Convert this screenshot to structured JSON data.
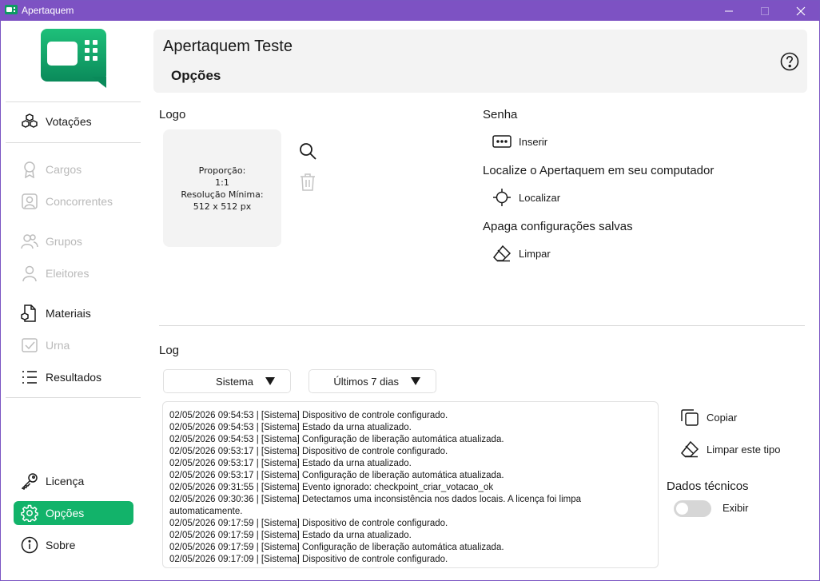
{
  "window": {
    "title": "Apertaquem"
  },
  "colors": {
    "titlebar": "#7d52c3",
    "accent": "#12b36a",
    "brand": "#0c9a63"
  },
  "sidebar": {
    "items": [
      {
        "label": "Votações",
        "icon": "cubes-icon",
        "state": "normal"
      },
      {
        "label": "Cargos",
        "icon": "ribbon-icon",
        "state": "disabled"
      },
      {
        "label": "Concorrentes",
        "icon": "person-card-icon",
        "state": "disabled"
      },
      {
        "label": "Grupos",
        "icon": "people-icon",
        "state": "disabled"
      },
      {
        "label": "Eleitores",
        "icon": "person-icon",
        "state": "disabled"
      },
      {
        "label": "Materiais",
        "icon": "document-cube-icon",
        "state": "normal"
      },
      {
        "label": "Urna",
        "icon": "ballot-box-icon",
        "state": "disabled"
      },
      {
        "label": "Resultados",
        "icon": "list-icon",
        "state": "normal"
      },
      {
        "label": "Licença",
        "icon": "key-icon",
        "state": "normal"
      },
      {
        "label": "Opções",
        "icon": "gear-icon",
        "state": "active"
      },
      {
        "label": "Sobre",
        "icon": "info-icon",
        "state": "normal"
      }
    ]
  },
  "header": {
    "app_name": "Apertaquem Teste",
    "page_title": "Opções"
  },
  "logo": {
    "label": "Logo",
    "drop_lines": [
      "Proporção:",
      "1:1",
      "Resolução Mínima:",
      "512 x 512 px"
    ]
  },
  "password": {
    "label": "Senha",
    "action": "Inserir"
  },
  "locate": {
    "label": "Localize o Apertaquem em seu computador",
    "action": "Localizar"
  },
  "clear_settings": {
    "label": "Apaga configurações salvas",
    "action": "Limpar"
  },
  "log": {
    "label": "Log",
    "type_filter": "Sistema",
    "period_filter": "Últimos 7 dias",
    "lines": [
      "02/05/2026 09:54:53 | [Sistema] Dispositivo de controle configurado.",
      "02/05/2026 09:54:53 | [Sistema] Estado da urna atualizado.",
      "02/05/2026 09:54:53 | [Sistema] Configuração de liberação automática atualizada.",
      "02/05/2026 09:53:17 | [Sistema] Dispositivo de controle configurado.",
      "02/05/2026 09:53:17 | [Sistema] Estado da urna atualizado.",
      "02/05/2026 09:53:17 | [Sistema] Configuração de liberação automática atualizada.",
      "02/05/2026 09:31:55 | [Sistema] Evento ignorado: checkpoint_criar_votacao_ok",
      "02/05/2026 09:30:36 | [Sistema] Detectamos uma inconsistência nos dados locais. A licença foi limpa automaticamente.",
      "02/05/2026 09:17:59 | [Sistema] Dispositivo de controle configurado.",
      "02/05/2026 09:17:59 | [Sistema] Estado da urna atualizado.",
      "02/05/2026 09:17:59 | [Sistema] Configuração de liberação automática atualizada.",
      "02/05/2026 09:17:09 | [Sistema] Dispositivo de controle configurado."
    ],
    "copy_action": "Copiar",
    "clear_type_action": "Limpar este tipo",
    "technical_label": "Dados técnicos",
    "show_label": "Exibir",
    "show_technical": false
  }
}
